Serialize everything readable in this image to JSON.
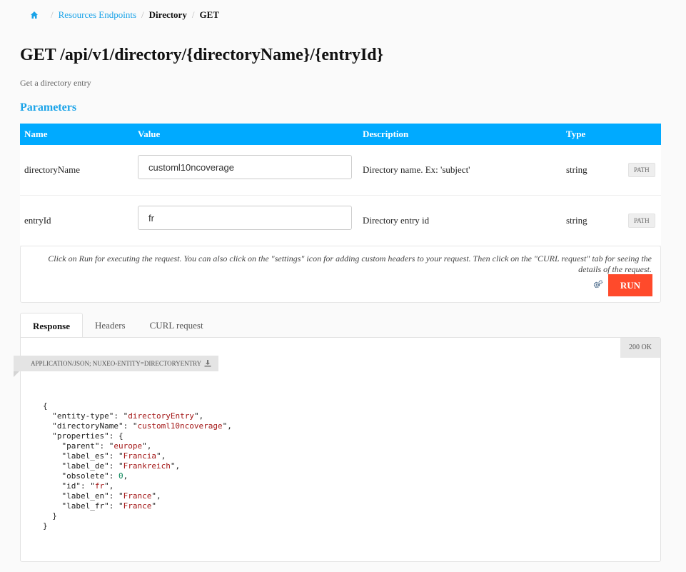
{
  "breadcrumb": {
    "home_icon": "home-icon",
    "items": [
      "Resources Endpoints",
      "Directory",
      "GET"
    ]
  },
  "page": {
    "title": "GET /api/v1/directory/{directoryName}/{entryId}",
    "subtitle": "Get a directory entry",
    "section_title": "Parameters"
  },
  "params": {
    "headers": [
      "Name",
      "Value",
      "Description",
      "Type"
    ],
    "rows": [
      {
        "name": "directoryName",
        "value": "customl10ncoverage",
        "description": "Directory name. Ex: 'subject'",
        "type": "string",
        "badge": "PATH"
      },
      {
        "name": "entryId",
        "value": "fr",
        "description": "Directory entry id",
        "type": "string",
        "badge": "PATH"
      }
    ]
  },
  "run": {
    "help_text": "Click on Run for executing the request. You can also click on the \"settings\" icon for adding custom headers to your request. Then click on the \"CURL request\" tab for seeing the details of the request.",
    "button_label": "RUN",
    "settings_icon": "gear-icon"
  },
  "tabs": [
    "Response",
    "Headers",
    "CURL request"
  ],
  "response": {
    "status": "200 OK",
    "content_type": "APPLICATION/JSON; NUXEO-ENTITY=DIRECTORYENTRY",
    "download_icon": "download-icon",
    "json": {
      "entity_type": "directoryEntry",
      "directory_name": "customl10ncoverage",
      "parent": "europe",
      "label_es": "Francia",
      "label_de": "Frankreich",
      "obsolete": "0",
      "id": "fr",
      "label_en": "France",
      "label_fr": "France"
    }
  },
  "colors": {
    "accent": "#00aaff",
    "link": "#1aa3e8",
    "run_button": "#ff4a2b"
  }
}
